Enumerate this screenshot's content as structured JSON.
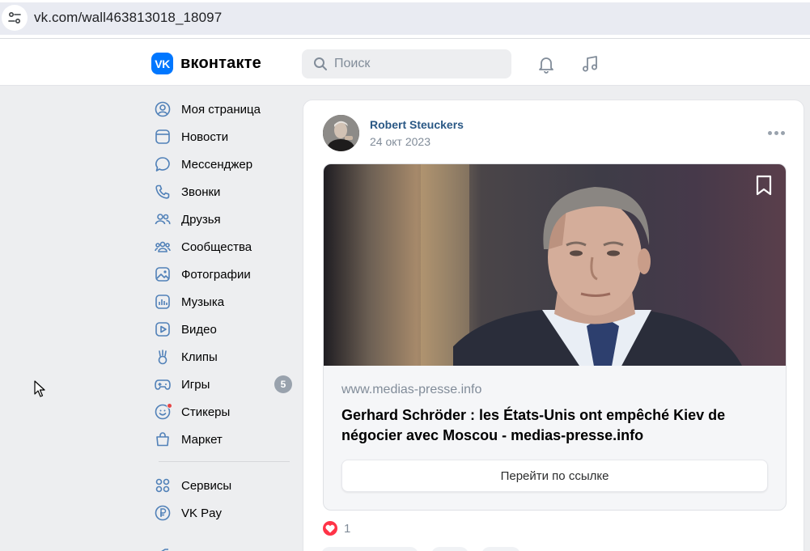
{
  "browser": {
    "url": "vk.com/wall463813018_18097"
  },
  "header": {
    "logo_text": "вконтакте",
    "search_placeholder": "Поиск",
    "accent_color": "#0077ff"
  },
  "sidebar": {
    "items": [
      {
        "label": "Моя страница",
        "icon": "user-circle-icon"
      },
      {
        "label": "Новости",
        "icon": "news-icon"
      },
      {
        "label": "Мессенджер",
        "icon": "message-icon"
      },
      {
        "label": "Звонки",
        "icon": "phone-icon"
      },
      {
        "label": "Друзья",
        "icon": "friends-icon"
      },
      {
        "label": "Сообщества",
        "icon": "communities-icon"
      },
      {
        "label": "Фотографии",
        "icon": "photo-icon"
      },
      {
        "label": "Музыка",
        "icon": "music-icon"
      },
      {
        "label": "Видео",
        "icon": "video-icon"
      },
      {
        "label": "Клипы",
        "icon": "clips-icon"
      },
      {
        "label": "Игры",
        "icon": "gamepad-icon",
        "badge": "5"
      },
      {
        "label": "Стикеры",
        "icon": "sticker-icon"
      },
      {
        "label": "Маркет",
        "icon": "market-bag-icon"
      }
    ],
    "services": [
      {
        "label": "Сервисы",
        "icon": "services-grid-icon"
      },
      {
        "label": "VK Pay",
        "icon": "vkpay-icon"
      }
    ]
  },
  "post": {
    "author": "Robert Steuckers",
    "date": "24 окт 2023",
    "link": {
      "domain": "www.medias-presse.info",
      "title": "Gerhard Schröder : les États-Unis ont empêché Kiev de négocier avec Moscou - medias-presse.info",
      "button_label": "Перейти по ссылке"
    },
    "likes_count": "1"
  }
}
